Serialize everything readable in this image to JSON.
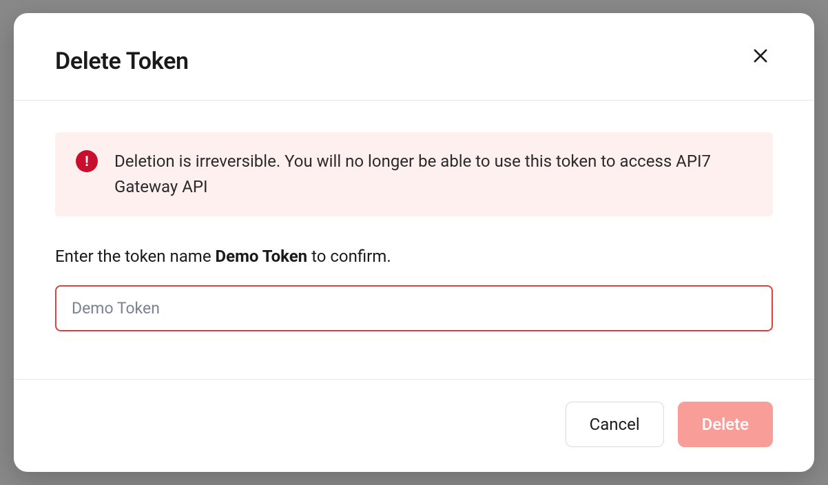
{
  "modal": {
    "title": "Delete Token",
    "alert": {
      "icon_name": "exclamation-icon",
      "message": "Deletion is irreversible. You will no longer be able to use this token to access API7 Gateway API"
    },
    "confirm": {
      "prefix": "Enter the token name ",
      "token_name": "Demo Token",
      "suffix": " to confirm."
    },
    "input": {
      "placeholder": "Demo Token",
      "value": ""
    },
    "buttons": {
      "cancel": "Cancel",
      "delete": "Delete"
    }
  },
  "colors": {
    "danger": "#C8102E",
    "danger_light": "#F89D98",
    "alert_bg": "#FDF0EF",
    "input_border": "#E03E3E"
  }
}
